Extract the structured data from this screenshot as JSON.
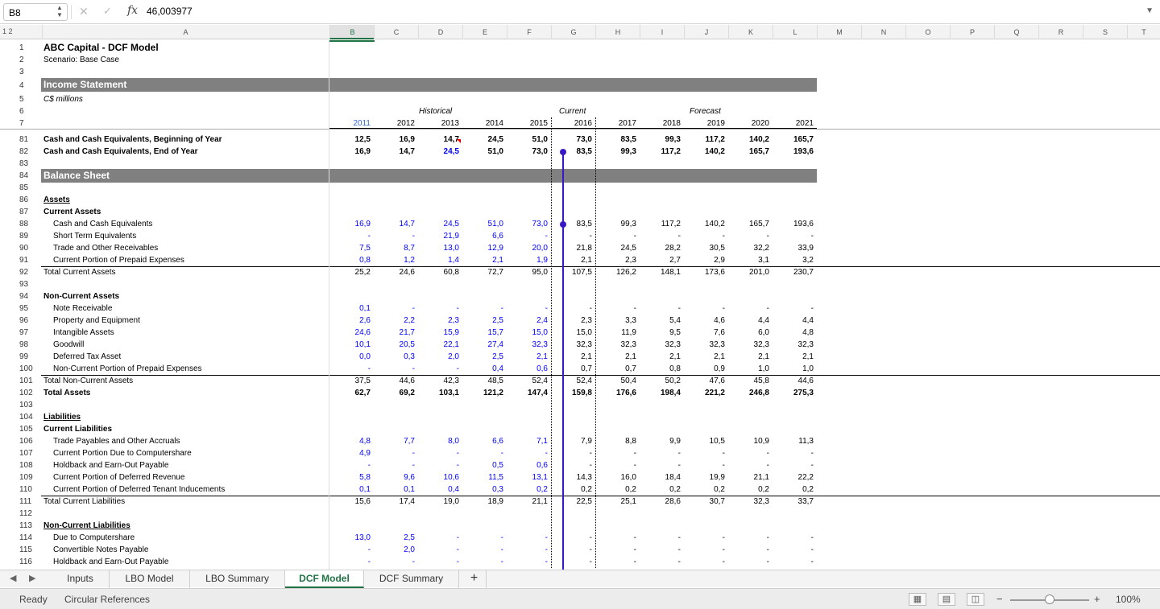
{
  "formula_bar": {
    "name_box": "B8",
    "fx_label": "fx",
    "value": "46,003977"
  },
  "columns": [
    "A",
    "B",
    "C",
    "D",
    "E",
    "F",
    "G",
    "H",
    "I",
    "J",
    "K",
    "L",
    "M",
    "N",
    "O",
    "P",
    "Q",
    "R",
    "S",
    "T"
  ],
  "outline_levels": "1 2",
  "title": "ABC Capital - DCF Model",
  "scenario": "Scenario: Base Case",
  "income_statement": "Income Statement",
  "units": "C$ millions",
  "period_groups": {
    "historical": "Historical",
    "current": "Current",
    "forecast": "Forecast"
  },
  "years": [
    "2011",
    "2012",
    "2013",
    "2014",
    "2015",
    "2016",
    "2017",
    "2018",
    "2019",
    "2020",
    "2021"
  ],
  "balance_sheet": "Balance Sheet",
  "rows": [
    {
      "n": "81",
      "label": "Cash and Cash Equivalents, Beginning of Year",
      "bold": true,
      "vals": [
        "12,5",
        "16,9",
        "14,7",
        "24,5",
        "51,0",
        "73,0",
        "83,5",
        "99,3",
        "117,2",
        "140,2",
        "165,7"
      ]
    },
    {
      "n": "82",
      "label": "Cash and Cash Equivalents, End of Year",
      "bold": true,
      "vals": [
        "16,9",
        "14,7",
        "24,5",
        "51,0",
        "73,0",
        "83,5",
        "99,3",
        "117,2",
        "140,2",
        "165,7",
        "193,6"
      ]
    },
    {
      "n": "83",
      "label": "",
      "vals": []
    },
    {
      "n": "84",
      "label": "",
      "vals": []
    },
    {
      "n": "85",
      "label": "",
      "vals": []
    },
    {
      "n": "86",
      "label": "Assets",
      "vals": []
    },
    {
      "n": "87",
      "label": "Current Assets",
      "vals": []
    },
    {
      "n": "88",
      "label": "Cash and Cash Equivalents",
      "vals": [
        "16,9",
        "14,7",
        "24,5",
        "51,0",
        "73,0",
        "83,5",
        "99,3",
        "117,2",
        "140,2",
        "165,7",
        "193,6"
      ]
    },
    {
      "n": "89",
      "label": "Short Term Equivalents",
      "vals": [
        "-",
        "-",
        "21,9",
        "6,6",
        "-",
        "-",
        "-",
        "-",
        "-",
        "-",
        "-"
      ]
    },
    {
      "n": "90",
      "label": "Trade and Other Receivables",
      "vals": [
        "7,5",
        "8,7",
        "13,0",
        "12,9",
        "20,0",
        "21,8",
        "24,5",
        "28,2",
        "30,5",
        "32,2",
        "33,9"
      ]
    },
    {
      "n": "91",
      "label": "Current Portion of Prepaid Expenses",
      "vals": [
        "0,8",
        "1,2",
        "1,4",
        "2,1",
        "1,9",
        "2,1",
        "2,3",
        "2,7",
        "2,9",
        "3,1",
        "3,2"
      ]
    },
    {
      "n": "92",
      "label": "Total Current Assets",
      "vals": [
        "25,2",
        "24,6",
        "60,8",
        "72,7",
        "95,0",
        "107,5",
        "126,2",
        "148,1",
        "173,6",
        "201,0",
        "230,7"
      ]
    },
    {
      "n": "93",
      "label": "",
      "vals": []
    },
    {
      "n": "94",
      "label": "Non-Current Assets",
      "vals": []
    },
    {
      "n": "95",
      "label": "Note Receivable",
      "vals": [
        "0,1",
        "-",
        "-",
        "-",
        "-",
        "-",
        "-",
        "-",
        "-",
        "-",
        "-"
      ]
    },
    {
      "n": "96",
      "label": "Property and Equipment",
      "vals": [
        "2,6",
        "2,2",
        "2,3",
        "2,5",
        "2,4",
        "2,3",
        "3,3",
        "5,4",
        "4,6",
        "4,4",
        "4,4"
      ]
    },
    {
      "n": "97",
      "label": "Intangible Assets",
      "vals": [
        "24,6",
        "21,7",
        "15,9",
        "15,7",
        "15,0",
        "15,0",
        "11,9",
        "9,5",
        "7,6",
        "6,0",
        "4,8"
      ]
    },
    {
      "n": "98",
      "label": "Goodwill",
      "vals": [
        "10,1",
        "20,5",
        "22,1",
        "27,4",
        "32,3",
        "32,3",
        "32,3",
        "32,3",
        "32,3",
        "32,3",
        "32,3"
      ]
    },
    {
      "n": "99",
      "label": "Deferred Tax Asset",
      "vals": [
        "0,0",
        "0,3",
        "2,0",
        "2,5",
        "2,1",
        "2,1",
        "2,1",
        "2,1",
        "2,1",
        "2,1",
        "2,1"
      ]
    },
    {
      "n": "100",
      "label": "Non-Current Portion of Prepaid Expenses",
      "vals": [
        "-",
        "-",
        "-",
        "0,4",
        "0,6",
        "0,7",
        "0,7",
        "0,8",
        "0,9",
        "1,0",
        "1,0"
      ]
    },
    {
      "n": "101",
      "label": "Total Non-Current Assets",
      "vals": [
        "37,5",
        "44,6",
        "42,3",
        "48,5",
        "52,4",
        "52,4",
        "50,4",
        "50,2",
        "47,6",
        "45,8",
        "44,6"
      ]
    },
    {
      "n": "102",
      "label": "Total Assets",
      "vals": [
        "62,7",
        "69,2",
        "103,1",
        "121,2",
        "147,4",
        "159,8",
        "176,6",
        "198,4",
        "221,2",
        "246,8",
        "275,3"
      ]
    },
    {
      "n": "103",
      "label": "",
      "vals": []
    },
    {
      "n": "104",
      "label": "Liabilities",
      "vals": []
    },
    {
      "n": "105",
      "label": "Current Liabilities",
      "vals": []
    },
    {
      "n": "106",
      "label": "Trade Payables and Other Accruals",
      "vals": [
        "4,8",
        "7,7",
        "8,0",
        "6,6",
        "7,1",
        "7,9",
        "8,8",
        "9,9",
        "10,5",
        "10,9",
        "11,3"
      ]
    },
    {
      "n": "107",
      "label": "Current Portion Due to Computershare",
      "vals": [
        "4,9",
        "-",
        "-",
        "-",
        "-",
        "-",
        "-",
        "-",
        "-",
        "-",
        "-"
      ]
    },
    {
      "n": "108",
      "label": "Holdback and Earn-Out Payable",
      "vals": [
        "-",
        "-",
        "-",
        "0,5",
        "0,6",
        "-",
        "-",
        "-",
        "-",
        "-",
        "-"
      ]
    },
    {
      "n": "109",
      "label": "Current Portion of Deferred Revenue",
      "vals": [
        "5,8",
        "9,6",
        "10,6",
        "11,5",
        "13,1",
        "14,3",
        "16,0",
        "18,4",
        "19,9",
        "21,1",
        "22,2"
      ]
    },
    {
      "n": "110",
      "label": "Current Portion of Deferred Tenant Inducements",
      "vals": [
        "0,1",
        "0,1",
        "0,4",
        "0,3",
        "0,2",
        "0,2",
        "0,2",
        "0,2",
        "0,2",
        "0,2",
        "0,2"
      ]
    },
    {
      "n": "111",
      "label": "Total Current Liabilities",
      "vals": [
        "15,6",
        "17,4",
        "19,0",
        "18,9",
        "21,1",
        "22,5",
        "25,1",
        "28,6",
        "30,7",
        "32,3",
        "33,7"
      ]
    },
    {
      "n": "112",
      "label": "",
      "vals": []
    },
    {
      "n": "113",
      "label": "Non-Current Liabilities",
      "vals": []
    },
    {
      "n": "114",
      "label": "Due to Computershare",
      "vals": [
        "13,0",
        "2,5",
        "-",
        "-",
        "-",
        "-",
        "-",
        "-",
        "-",
        "-",
        "-"
      ]
    },
    {
      "n": "115",
      "label": "Convertible Notes Payable",
      "vals": [
        "-",
        "2,0",
        "-",
        "-",
        "-",
        "-",
        "-",
        "-",
        "-",
        "-",
        "-"
      ]
    },
    {
      "n": "116",
      "label": "Holdback and Earn-Out Payable",
      "vals": [
        "-",
        "-",
        "-",
        "-",
        "-",
        "-",
        "-",
        "-",
        "-",
        "-",
        "-"
      ]
    }
  ],
  "tabs": [
    "Inputs",
    "LBO Model",
    "LBO Summary",
    "DCF Model",
    "DCF Summary"
  ],
  "active_tab": "DCF Model",
  "add_sheet": "+",
  "status": {
    "ready": "Ready",
    "circular": "Circular References",
    "zoom": "100%",
    "zoom_minus": "−",
    "zoom_plus": "+"
  }
}
